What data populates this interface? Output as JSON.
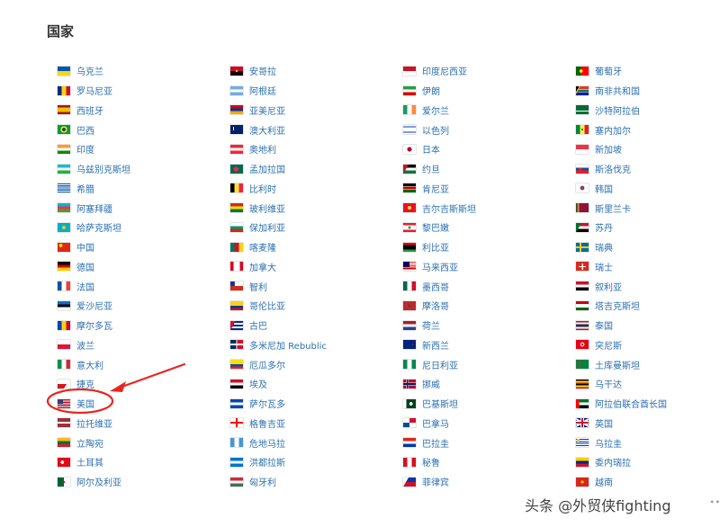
{
  "section": {
    "title": "国家"
  },
  "watermark": {
    "text": "头条 @外贸侠fighting",
    "trail": "∙∙"
  },
  "highlight": {
    "column": 0,
    "row": 17
  },
  "columns": [
    [
      {
        "label": "乌克兰",
        "flag": "ua"
      },
      {
        "label": "罗马尼亚",
        "flag": "ro"
      },
      {
        "label": "西班牙",
        "flag": "es"
      },
      {
        "label": "巴西",
        "flag": "br"
      },
      {
        "label": "印度",
        "flag": "in"
      },
      {
        "label": "乌兹别克斯坦",
        "flag": "uz"
      },
      {
        "label": "希腊",
        "flag": "gr"
      },
      {
        "label": "阿塞拜疆",
        "flag": "az"
      },
      {
        "label": "哈萨克斯坦",
        "flag": "kz"
      },
      {
        "label": "中国",
        "flag": "cn"
      },
      {
        "label": "德国",
        "flag": "de"
      },
      {
        "label": "法国",
        "flag": "fr"
      },
      {
        "label": "爱沙尼亚",
        "flag": "ee"
      },
      {
        "label": "摩尔多瓦",
        "flag": "md"
      },
      {
        "label": "波兰",
        "flag": "pl"
      },
      {
        "label": "意大利",
        "flag": "it"
      },
      {
        "label": "捷克",
        "flag": "cz"
      },
      {
        "label": "美国",
        "flag": "us"
      },
      {
        "label": "拉托维亚",
        "flag": "lv"
      },
      {
        "label": "立陶宛",
        "flag": "lt"
      },
      {
        "label": "土耳其",
        "flag": "tr"
      },
      {
        "label": "阿尔及利亚",
        "flag": "dz"
      }
    ],
    [
      {
        "label": "安哥拉",
        "flag": "ao"
      },
      {
        "label": "阿根廷",
        "flag": "ar"
      },
      {
        "label": "亚美尼亚",
        "flag": "am"
      },
      {
        "label": "澳大利亚",
        "flag": "au"
      },
      {
        "label": "奥地利",
        "flag": "at"
      },
      {
        "label": "孟加拉国",
        "flag": "bd"
      },
      {
        "label": "比利时",
        "flag": "be"
      },
      {
        "label": "玻利维亚",
        "flag": "bo"
      },
      {
        "label": "保加利亚",
        "flag": "bg"
      },
      {
        "label": "喀麦隆",
        "flag": "cm"
      },
      {
        "label": "加拿大",
        "flag": "ca"
      },
      {
        "label": "智利",
        "flag": "cl"
      },
      {
        "label": "哥伦比亚",
        "flag": "co"
      },
      {
        "label": "古巴",
        "flag": "cu"
      },
      {
        "label": "多米尼加 Rebublic",
        "flag": "do"
      },
      {
        "label": "厄瓜多尔",
        "flag": "ec"
      },
      {
        "label": "埃及",
        "flag": "eg"
      },
      {
        "label": "萨尔瓦多",
        "flag": "sv"
      },
      {
        "label": "格鲁吉亚",
        "flag": "ge"
      },
      {
        "label": "危地马拉",
        "flag": "gt"
      },
      {
        "label": "洪都拉斯",
        "flag": "hn"
      },
      {
        "label": "匈牙利",
        "flag": "hu"
      }
    ],
    [
      {
        "label": "印度尼西亚",
        "flag": "id"
      },
      {
        "label": "伊朗",
        "flag": "ir"
      },
      {
        "label": "爱尔兰",
        "flag": "ie"
      },
      {
        "label": "以色列",
        "flag": "il"
      },
      {
        "label": "日本",
        "flag": "jp"
      },
      {
        "label": "约旦",
        "flag": "jo"
      },
      {
        "label": "肯尼亚",
        "flag": "ke"
      },
      {
        "label": "吉尔吉斯斯坦",
        "flag": "kg"
      },
      {
        "label": "黎巴嫩",
        "flag": "lb"
      },
      {
        "label": "利比亚",
        "flag": "ly"
      },
      {
        "label": "马来西亚",
        "flag": "my"
      },
      {
        "label": "墨西哥",
        "flag": "mx"
      },
      {
        "label": "摩洛哥",
        "flag": "ma"
      },
      {
        "label": "荷兰",
        "flag": "nl"
      },
      {
        "label": "新西兰",
        "flag": "nz"
      },
      {
        "label": "尼日利亚",
        "flag": "ng"
      },
      {
        "label": "挪威",
        "flag": "no"
      },
      {
        "label": "巴基斯坦",
        "flag": "pk"
      },
      {
        "label": "巴拿马",
        "flag": "pa"
      },
      {
        "label": "巴拉圭",
        "flag": "py"
      },
      {
        "label": "秘鲁",
        "flag": "pe"
      },
      {
        "label": "菲律宾",
        "flag": "ph"
      }
    ],
    [
      {
        "label": "葡萄牙",
        "flag": "pt"
      },
      {
        "label": "南非共和国",
        "flag": "za"
      },
      {
        "label": "沙特阿拉伯",
        "flag": "sa"
      },
      {
        "label": "塞内加尔",
        "flag": "sn"
      },
      {
        "label": "新加坡",
        "flag": "sg"
      },
      {
        "label": "斯洛伐克",
        "flag": "sk"
      },
      {
        "label": "韩国",
        "flag": "kr"
      },
      {
        "label": "斯里兰卡",
        "flag": "lk"
      },
      {
        "label": "苏丹",
        "flag": "sd"
      },
      {
        "label": "瑞典",
        "flag": "se"
      },
      {
        "label": "瑞士",
        "flag": "ch"
      },
      {
        "label": "叙利亚",
        "flag": "sy"
      },
      {
        "label": "塔吉克斯坦",
        "flag": "tj"
      },
      {
        "label": "泰国",
        "flag": "th"
      },
      {
        "label": "突尼斯",
        "flag": "tn"
      },
      {
        "label": "土库曼斯坦",
        "flag": "tm"
      },
      {
        "label": "乌干达",
        "flag": "ug"
      },
      {
        "label": "阿拉伯联合酋长国",
        "flag": "ae"
      },
      {
        "label": "英国",
        "flag": "gb"
      },
      {
        "label": "乌拉圭",
        "flag": "uy"
      },
      {
        "label": "委内瑞拉",
        "flag": "ve"
      },
      {
        "label": "越南",
        "flag": "vn"
      }
    ]
  ],
  "flag_styles": {
    "ua": "linear-gradient(#0057b7 50%, #ffd700 50%)",
    "ro": "linear-gradient(90deg, #002b7f 33.3%, #fcd116 33.3% 66.6%, #ce1126 66.6%)",
    "es": "linear-gradient(#aa151b 25%, #f1bf00 25% 75%, #aa151b 75%)",
    "br": "radial-gradient(circle at 50% 50%, #1e3a8a 22%, #ffdf00 23% 42%, #009c3b 43%)",
    "in": "linear-gradient(#ff9933 33.3%, #ffffff 33.3% 66.6%, #138808 66.6%)",
    "uz": "linear-gradient(#1eb5e0 33%, #ce1126 33% 37%, #ffffff 37% 63%, #ce1126 63% 67%, #1eb53a 67%)",
    "gr": "repeating-linear-gradient(#0d5eaf 0 11.1%, #ffffff 11.1% 22.2%)",
    "az": "linear-gradient(#00b5e2 33.3%, #ef3340 33.3% 66.6%, #509e2f 66.6%)",
    "kz": "radial-gradient(circle at 50% 50%, #fec50c 22%, #00afca 24%)",
    "cn": "radial-gradient(circle at 25% 30%, #ffde00 14%, #de2910 16%)",
    "de": "linear-gradient(#000000 33.3%, #dd0000 33.3% 66.6%, #ffce00 66.6%)",
    "fr": "linear-gradient(90deg, #0055a4 33.3%, #ffffff 33.3% 66.6%, #ef4135 66.6%)",
    "ee": "linear-gradient(#0072ce 33.3%, #000000 33.3% 66.6%, #ffffff 66.6%)",
    "md": "linear-gradient(90deg, #0046ae 33.3%, #ffd200 33.3% 66.6%, #cc092f 66.6%)",
    "pl": "linear-gradient(#ffffff 50%, #dc143c 50%)",
    "it": "linear-gradient(90deg, #009246 33.3%, #ffffff 33.3% 66.6%, #ce2b37 66.6%)",
    "cz": "linear-gradient(-60deg, #ffffff 0 35%, transparent 35%), linear-gradient(#ffffff 50%, #d7141a 50%), #11457e",
    "us": "linear-gradient(#3c3b6e, #3c3b6e) 0 0 / 45% 55% no-repeat, repeating-linear-gradient(#b22234 0 7.7%, #ffffff 7.7% 15.4%)",
    "lv": "linear-gradient(#9e3039 40%, #ffffff 40% 60%, #9e3039 60%)",
    "lt": "linear-gradient(#fdb913 33.3%, #006a44 33.3% 66.6%, #c1272d 66.6%)",
    "tr": "radial-gradient(circle at 38% 50%, #ffffff 18%, #e30a17 20%)",
    "dz": "radial-gradient(circle at 50% 50%, #d21034 14%, transparent 16%), linear-gradient(90deg, #006233 50%, #ffffff 50%)",
    "ao": "radial-gradient(circle at 50% 50%, #ffcb00 14%, transparent 16%), linear-gradient(#cc092f 50%, #000000 50%)",
    "ar": "linear-gradient(#74acdf 33.3%, #ffffff 33.3% 66.6%, #74acdf 66.6%)",
    "am": "linear-gradient(#d90012 33.3%, #0033a0 33.3% 66.6%, #f2a800 66.6%)",
    "au": "linear-gradient(#ffffff, #ffffff) 20% 25% / 10% 40% no-repeat, #012169",
    "at": "linear-gradient(#ed2939 33.3%, #ffffff 33.3% 66.6%, #ed2939 66.6%)",
    "bd": "radial-gradient(circle at 45% 50%, #f42a41 28%, #006a4e 30%)",
    "be": "linear-gradient(90deg, #000000 33.3%, #fae042 33.3% 66.6%, #ed2939 66.6%)",
    "bo": "linear-gradient(#d52b1e 33.3%, #f9e300 33.3% 66.6%, #007934 66.6%)",
    "bg": "linear-gradient(#ffffff 33.3%, #00966e 33.3% 66.6%, #d62612 66.6%)",
    "cm": "linear-gradient(90deg, #007a5e 33.3%, #ce1126 33.3% 66.6%, #fcd116 66.6%)",
    "ca": "linear-gradient(90deg, #d80621 25%, #ffffff 25% 75%, #d80621 75%)",
    "cl": "linear-gradient(#0039a6, #0039a6) 0 0 / 35% 50% no-repeat, linear-gradient(#ffffff 50%, #d52b1e 50%)",
    "co": "linear-gradient(#fcd116 50%, #003893 50% 75%, #ce1126 75%)",
    "cu": "linear-gradient(120deg, #cf142b 30%, transparent 30%), repeating-linear-gradient(#002a8f 0 20%, #ffffff 20% 40%)",
    "do": "linear-gradient(90deg, transparent 45%, #ffffff 45% 55%, transparent 55%), linear-gradient(transparent 42%, #ffffff 42% 58%, transparent 58%), linear-gradient(90deg, #002d62 50%, #ce1126 50%)",
    "ec": "linear-gradient(#ffdd00 50%, #034ea2 50% 75%, #ed1c24 75%)",
    "eg": "linear-gradient(#ce1126 33.3%, #ffffff 33.3% 66.6%, #000000 66.6%)",
    "sv": "linear-gradient(#0047ab 33.3%, #ffffff 33.3% 66.6%, #0047ab 66.6%)",
    "ge": "linear-gradient(90deg, transparent 42%, #ff0000 42% 58%, transparent 58%), linear-gradient(transparent 40%, #ff0000 40% 60%, transparent 60%), #ffffff",
    "gt": "linear-gradient(90deg, #4997d0 33.3%, #ffffff 33.3% 66.6%, #4997d0 66.6%)",
    "hn": "linear-gradient(#0073cf 33.3%, #ffffff 33.3% 66.6%, #0073cf 66.6%)",
    "hu": "linear-gradient(#ce2939 33.3%, #ffffff 33.3% 66.6%, #477050 66.6%)",
    "id": "linear-gradient(#ce1126 50%, #ffffff 50%)",
    "ir": "linear-gradient(#239f40 33.3%, #ffffff 33.3% 66.6%, #da0000 66.6%)",
    "ie": "linear-gradient(90deg, #169b62 33.3%, #ffffff 33.3% 66.6%, #ff883e 66.6%)",
    "il": "linear-gradient(#ffffff 15%, #0038b8 15% 25%, #ffffff 25% 75%, #0038b8 75% 85%, #ffffff 85%)",
    "jp": "radial-gradient(circle at 50% 50%, #bc002d 28%, #ffffff 30%)",
    "jo": "linear-gradient(120deg, #ce1126 30%, transparent 30%), linear-gradient(#000000 33.3%, #ffffff 33.3% 66.6%, #007a3d 66.6%)",
    "ke": "linear-gradient(#000000 30%, #ffffff 30% 35%, #bb0000 35% 65%, #ffffff 65% 70%, #006600 70%)",
    "kg": "radial-gradient(circle at 50% 50%, #ffef00 22%, #e8112d 24%)",
    "lb": "radial-gradient(circle at 50% 50%, #00a651 16%, transparent 18%), linear-gradient(#ed1c24 25%, #ffffff 25% 75%, #ed1c24 75%)",
    "ly": "linear-gradient(#e70013 25%, #000000 25% 75%, #239e46 75%)",
    "my": "linear-gradient(#010066, #010066) 0 0 / 50% 57% no-repeat, repeating-linear-gradient(#cc0001 0 7.1%, #ffffff 7.1% 14.2%)",
    "mx": "linear-gradient(90deg, #006847 33.3%, #ffffff 33.3% 66.6%, #ce1126 66.6%)",
    "ma": "radial-gradient(circle at 50% 50%, #006233 14%, #c1272d 18%)",
    "nl": "linear-gradient(#ae1c28 33.3%, #ffffff 33.3% 66.6%, #21468b 66.6%)",
    "nz": "linear-gradient(#c8102e, #c8102e) 75% 50% / 6% 20% no-repeat, #00247d",
    "ng": "linear-gradient(90deg, #008751 33.3%, #ffffff 33.3% 66.6%, #008751 66.6%)",
    "no": "linear-gradient(90deg, transparent 28%, #00205b 28% 40%, transparent 40%), linear-gradient(transparent 42%, #00205b 42% 58%, transparent 58%), linear-gradient(90deg, transparent 24%, #ffffff 24% 44%, transparent 44%), linear-gradient(transparent 35%, #ffffff 35% 65%, transparent 65%), #ba0c2f",
    "pk": "radial-gradient(circle at 62% 50%, #ffffff 18%, transparent 20%), linear-gradient(90deg, #ffffff 25%, #01411c 25%)",
    "pa": "linear-gradient(#ffffff, #ffffff) 0 0 / 50% 50% no-repeat, linear-gradient(#d21034, #d21034) 100% 0 / 50% 50% no-repeat, linear-gradient(#005293, #005293) 0 100% / 50% 50% no-repeat, #ffffff",
    "py": "linear-gradient(#d52b1e 33.3%, #ffffff 33.3% 66.6%, #0038a8 66.6%)",
    "pe": "linear-gradient(90deg, #d91023 33.3%, #ffffff 33.3% 66.6%, #d91023 66.6%)",
    "ph": "linear-gradient(120deg, #ffffff 30%, transparent 30%), linear-gradient(#0038a8 50%, #ce1126 50%)",
    "pt": "radial-gradient(circle at 40% 50%, #ffe900 18%, transparent 20%), linear-gradient(90deg, #006600 40%, #ff0000 40%)",
    "za": "linear-gradient(120deg, #000000 18%, #ffb612 18% 25%, transparent 25%), linear-gradient(#de3831 33%, #ffffff 33% 38%, #007a4d 38% 62%, #ffffff 62% 67%, #002395 67%)",
    "sa": "linear-gradient(transparent 60%, #ffffff 60% 68%, transparent 68%), #006c35",
    "sn": "radial-gradient(circle at 50% 50%, #00853f 12%, transparent 14%), linear-gradient(90deg, #00853f 33.3%, #fdef42 33.3% 66.6%, #e31b23 66.6%)",
    "sg": "linear-gradient(#ef3340 50%, #ffffff 50%)",
    "sk": "radial-gradient(circle at 35% 50%, #ee1c25 16%, transparent 18%), linear-gradient(#ffffff 33.3%, #0b4ea2 33.3% 66.6%, #ee1c25 66.6%)",
    "kr": "radial-gradient(circle at 50% 50%, #cd2e3a 20%, #0047a0 22% 26%, #ffffff 28%)",
    "lk": "linear-gradient(90deg, #00534e 12%, #ff7300 12% 24%, #8d153a 24%)",
    "sd": "linear-gradient(120deg, #007229 30%, transparent 30%), linear-gradient(#d21034 33.3%, #ffffff 33.3% 66.6%, #000000 66.6%)",
    "se": "linear-gradient(90deg, transparent 30%, #fecc00 30% 42%, transparent 42%), linear-gradient(transparent 40%, #fecc00 40% 60%, transparent 60%), #006aa7",
    "ch": "linear-gradient(90deg, transparent 42%, #ffffff 42% 58%, transparent 58%) 50% 50% / 60% 70% no-repeat, linear-gradient(transparent 40%, #ffffff 40% 60%, transparent 60%) 50% 50% / 60% 70% no-repeat, #da291c",
    "sy": "linear-gradient(#ce1126 33.3%, #ffffff 33.3% 66.6%, #000000 66.6%)",
    "tj": "linear-gradient(#cc0000 28%, #ffffff 28% 72%, #006600 72%)",
    "th": "linear-gradient(#a51931 16%, #f4f5f8 16% 33%, #2d2a4a 33% 67%, #f4f5f8 67% 84%, #a51931 84%)",
    "tn": "radial-gradient(circle at 50% 50%, #e70013 14%, #ffffff 16% 26%, #e70013 28%)",
    "tm": "linear-gradient(90deg, #00843d 20%, #d22630 20% 32%, #00843d 32%)",
    "ug": "repeating-linear-gradient(#000000 0 16.6%, #fcdc04 16.6% 33.3%, #d90000 33.3% 50%)",
    "ae": "linear-gradient(90deg, #ff0000 25%, transparent 25%), linear-gradient(#00732f 33.3%, #ffffff 33.3% 66.6%, #000000 66.6%)",
    "gb": "linear-gradient(90deg, transparent 42%, #c8102e 42% 58%, transparent 58%), linear-gradient(transparent 38%, #c8102e 38% 62%, transparent 62%), linear-gradient(90deg, transparent 35%, #ffffff 35% 65%, transparent 65%), linear-gradient(transparent 30%, #ffffff 30% 70%, transparent 70%), linear-gradient(30deg, transparent 44%, #ffffff 44% 56%, transparent 56%), linear-gradient(-30deg, transparent 44%, #ffffff 44% 56%, transparent 56%), #012169",
    "uy": "radial-gradient(circle at 18% 25%, #fcd116 12%, transparent 14%), repeating-linear-gradient(#ffffff 0 11.1%, #0038a8 11.1% 22.2%)",
    "ve": "linear-gradient(#ffcc00 33.3%, #00247d 33.3% 66.6%, #cf142b 66.6%)",
    "vn": "radial-gradient(circle at 50% 50%, #ffcd00 18%, #da251d 20%)"
  }
}
